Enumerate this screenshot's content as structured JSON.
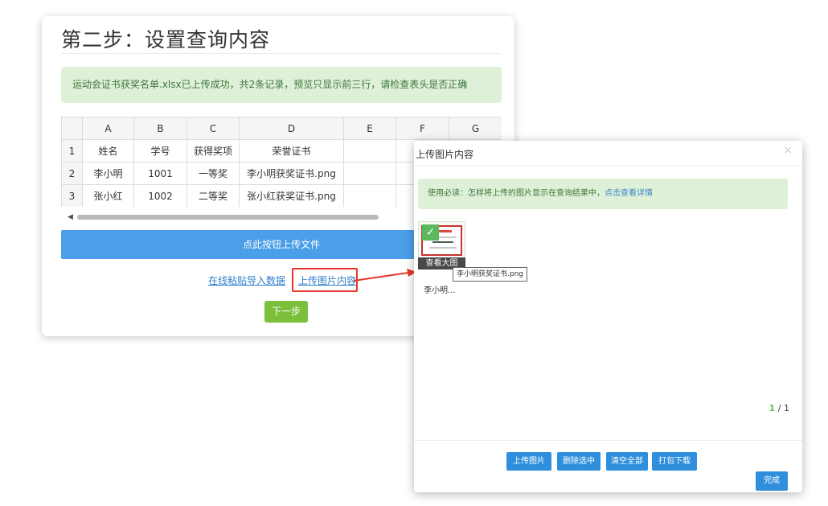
{
  "main": {
    "title": "第二步：设置查询内容",
    "notice": "运动会证书获奖名单.xlsx已上传成功，共2条记录，预览只显示前三行，请检查表头是否正确",
    "columns": [
      "",
      "A",
      "B",
      "C",
      "D",
      "E",
      "F",
      "G"
    ],
    "rows": [
      [
        "1",
        "姓名",
        "学号",
        "获得奖项",
        "荣誉证书",
        "",
        "",
        ""
      ],
      [
        "2",
        "李小明",
        "1001",
        "一等奖",
        "李小明获奖证书.png",
        "",
        "",
        ""
      ],
      [
        "3",
        "张小红",
        "1002",
        "二等奖",
        "张小红获奖证书.png",
        "",
        "",
        ""
      ]
    ],
    "upload_file_button": "点此按钮上传文件",
    "paste_link": "在线粘贴导入数据",
    "upload_image_link": "上传图片内容",
    "next_button": "下一步"
  },
  "dialog": {
    "title": "上传图片内容",
    "close": "×",
    "notice_prefix": "使用必读：怎样将上传的图片显示在查询结果中，",
    "notice_link": "点击查看详情",
    "thumbnail": {
      "view_large": "查看大图",
      "tooltip": "李小明获奖证书.png",
      "caption": "李小明...",
      "checked": "✓"
    },
    "pager": {
      "current": "1",
      "separator": " / ",
      "total": "1"
    },
    "buttons": {
      "upload": "上传图片",
      "delete": "删除选中",
      "clear": "清空全部",
      "pack": "打包下载",
      "done": "完成"
    }
  },
  "colors": {
    "accent": "#4a9fe8",
    "success": "#7cbf3b",
    "highlight": "#e8352a",
    "notice_bg": "#dff0d8"
  }
}
